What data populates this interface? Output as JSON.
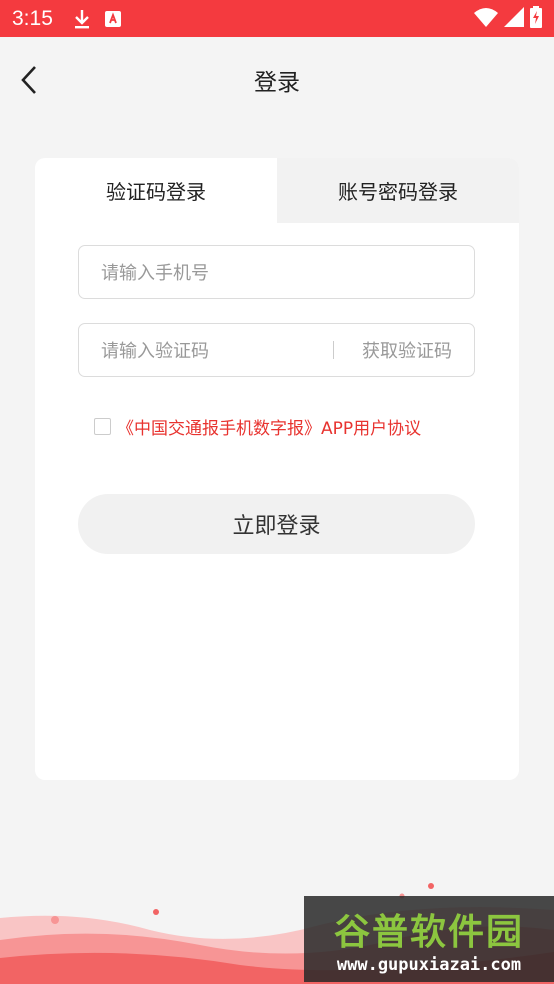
{
  "status_bar": {
    "time": "3:15",
    "icons": [
      "download-icon",
      "accessibility-app-icon",
      "wifi-icon",
      "signal-icon",
      "battery-charging-icon"
    ]
  },
  "header": {
    "title": "登录",
    "back_icon": "chevron-left-icon"
  },
  "tabs": {
    "sms_login": "验证码登录",
    "password_login": "账号密码登录",
    "active": "sms_login"
  },
  "form": {
    "phone_placeholder": "请输入手机号",
    "code_placeholder": "请输入验证码",
    "get_code_label": "获取验证码"
  },
  "agreement": {
    "checked": false,
    "text": "《中国交通报手机数字报》APP用户协议"
  },
  "login_button": "立即登录",
  "watermark": {
    "logo": "谷普软件园",
    "url": "www.gupuxiazai.com"
  },
  "colors": {
    "accent": "#f43a3f",
    "agreement_text": "#e8332f"
  }
}
